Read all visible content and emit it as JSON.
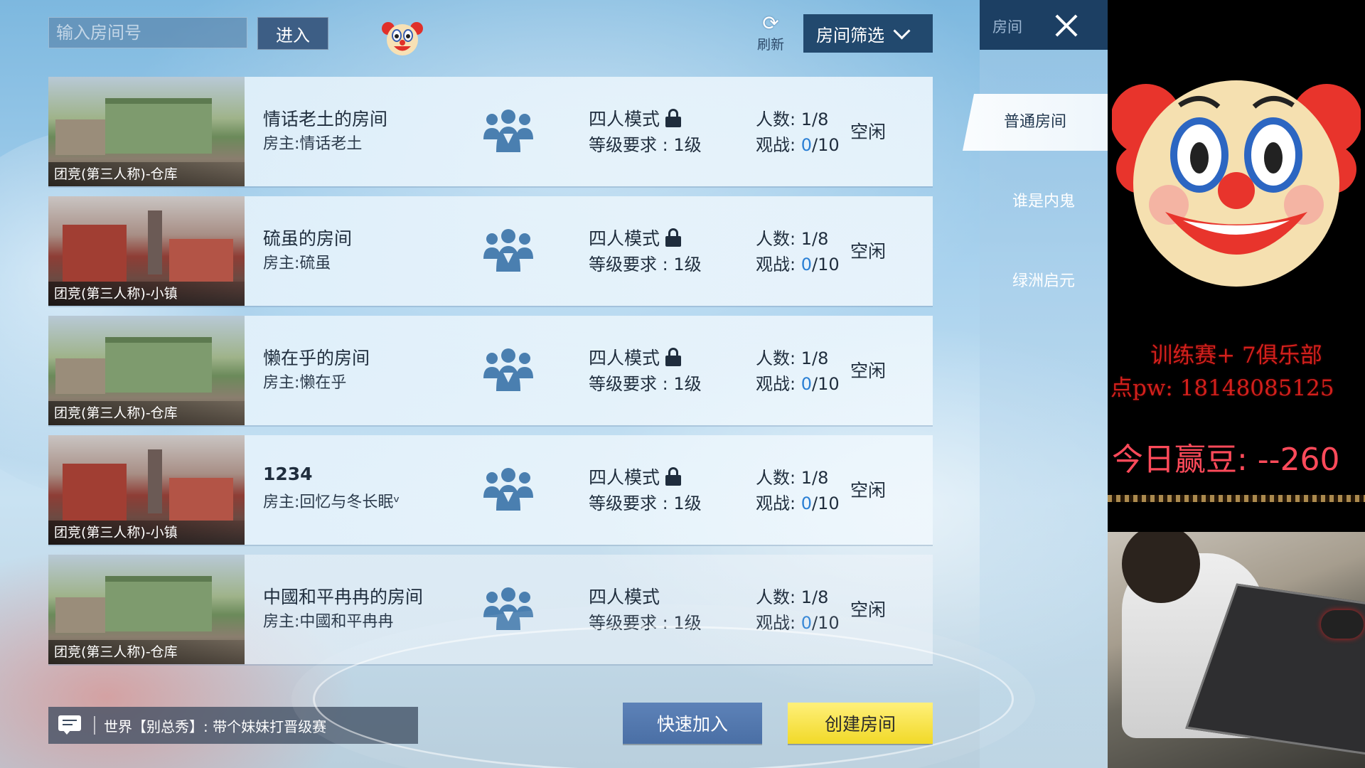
{
  "header": {
    "search_placeholder": "输入房间号",
    "enter_label": "进入",
    "refresh_label": "刷新",
    "filter_label": "房间筛选"
  },
  "tabs": {
    "header_title": "房间",
    "items": [
      {
        "label": "普通房间",
        "active": true
      },
      {
        "label": "谁是内鬼",
        "active": false
      },
      {
        "label": "绿洲启元",
        "active": false
      }
    ]
  },
  "rooms": [
    {
      "map_label": "团竞(第三人称)-仓库",
      "map_kind": "warehouse",
      "name": "情话老土的房间",
      "host": "房主:情话老土",
      "mode": "四人模式",
      "locked": true,
      "level": "等级要求 :  1级",
      "players_prefix": "人数:",
      "players": "1/8",
      "spectators_prefix": "观战:",
      "spectators_cur": "0",
      "spectators_max": "/10",
      "status": "空闲"
    },
    {
      "map_label": "团竞(第三人称)-小镇",
      "map_kind": "town",
      "name": "硫虽的房间",
      "host": "房主:硫虽",
      "mode": "四人模式",
      "locked": true,
      "level": "等级要求 :  1级",
      "players_prefix": "人数:",
      "players": "1/8",
      "spectators_prefix": "观战:",
      "spectators_cur": "0",
      "spectators_max": "/10",
      "status": "空闲"
    },
    {
      "map_label": "团竞(第三人称)-仓库",
      "map_kind": "warehouse",
      "name": "懒在乎的房间",
      "host": "房主:懒在乎",
      "mode": "四人模式",
      "locked": true,
      "level": "等级要求 :  1级",
      "players_prefix": "人数:",
      "players": "1/8",
      "spectators_prefix": "观战:",
      "spectators_cur": "0",
      "spectators_max": "/10",
      "status": "空闲"
    },
    {
      "map_label": "团竞(第三人称)-小镇",
      "map_kind": "town",
      "name": "1234",
      "host": "房主:回忆与冬长眠ᵛ",
      "mode": "四人模式",
      "locked": true,
      "level": "等级要求 :  1级",
      "players_prefix": "人数:",
      "players": "1/8",
      "spectators_prefix": "观战:",
      "spectators_cur": "0",
      "spectators_max": "/10",
      "status": "空闲"
    },
    {
      "map_label": "团竞(第三人称)-仓库",
      "map_kind": "warehouse",
      "name": "中國和平冉冉的房间",
      "host": "房主:中國和平冉冉",
      "mode": "四人模式",
      "locked": false,
      "level": "等级要求 :  1级",
      "players_prefix": "人数:",
      "players": "1/8",
      "spectators_prefix": "观战:",
      "spectators_cur": "0",
      "spectators_max": "/10",
      "status": "空闲"
    }
  ],
  "footer": {
    "chat_text": "世界【别总秀】: 带个妹妹打晋级赛",
    "quick_join_label": "快速加入",
    "create_room_label": "创建房间"
  },
  "overlay": {
    "promo_line1": "训练赛+    7俱乐部",
    "promo_line2": "点pw:  18148085125",
    "win_beans": "今日赢豆:  --260"
  },
  "colors": {
    "accent_yellow": "#f1d928",
    "accent_blue": "#4a6fa5",
    "filter_bg": "#22496e",
    "promo_red": "#d2201c",
    "beans_pink": "#ff4a5a"
  }
}
